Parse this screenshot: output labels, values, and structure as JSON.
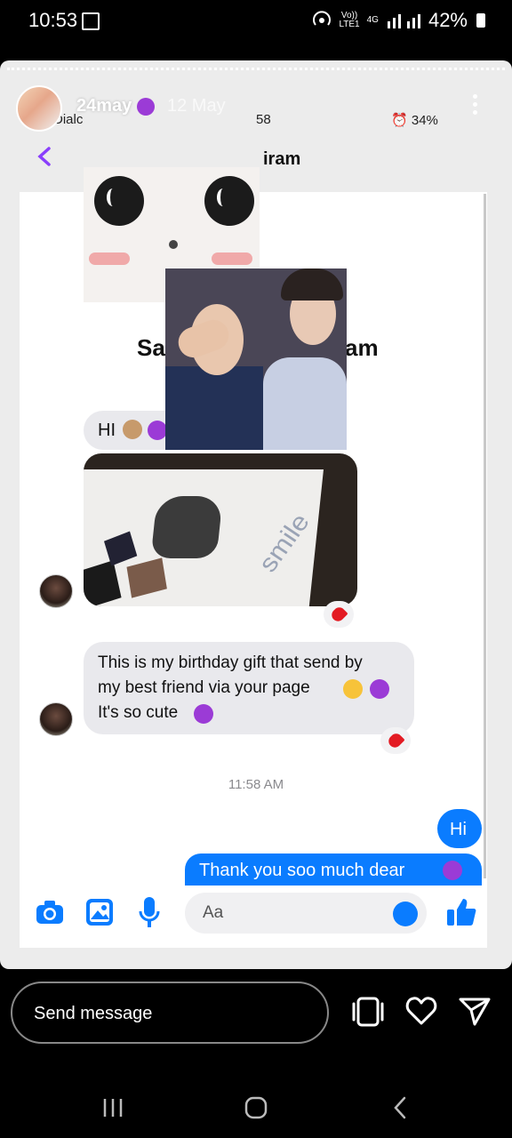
{
  "status_bar": {
    "time": "10:53",
    "network_top": "Vo))",
    "network_bottom": "LTE1",
    "network_type": "4G",
    "battery": "42%",
    "icons": [
      "image-icon",
      "hotspot-icon",
      "signal-icon",
      "battery-icon"
    ]
  },
  "story": {
    "username": "24may",
    "date": "12 May",
    "progress_color": "#ffffff"
  },
  "inner_screenshot": {
    "status_left": "Dialc",
    "status_time_frag": "58",
    "status_battery": "34%",
    "header_name_frag": "iram",
    "profile_name_left": "Sa",
    "profile_name_right": "am",
    "messages": {
      "hi_in": "HI",
      "long_in_1": "This is my birthday gift that send by",
      "long_in_2": "my best friend via your page",
      "long_in_3": "It's so cute",
      "time_label": "11:58 AM",
      "hi_out": "Hi",
      "thanks_out": "Thank you soo much dear"
    },
    "photo_text": "smile",
    "composer_placeholder": "Aa"
  },
  "reply": {
    "placeholder": "Send message"
  },
  "colors": {
    "messenger_blue": "#0a7cff",
    "purple_heart": "#9b3bd6",
    "back_chevron": "#8a3ffc"
  }
}
